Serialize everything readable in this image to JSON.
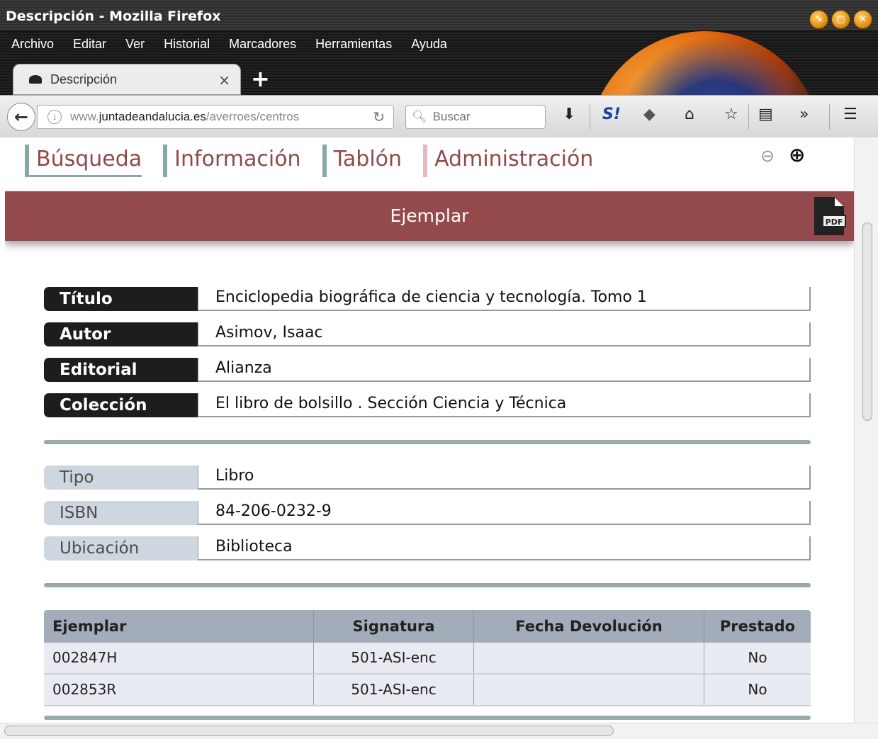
{
  "window": {
    "title": "Descripción - Mozilla Firefox"
  },
  "menubar": {
    "items": [
      "Archivo",
      "Editar",
      "Ver",
      "Historial",
      "Marcadores",
      "Herramientas",
      "Ayuda"
    ]
  },
  "tab": {
    "label": "Descripción",
    "close": "×",
    "new_tab": "+"
  },
  "navbar": {
    "url_prefix": "www.",
    "url_domain": "juntadeandalucia.es",
    "url_path": "/averroes/centros",
    "search_placeholder": "Buscar"
  },
  "site_nav": [
    "Búsqueda",
    "Información",
    "Tablón",
    "Administración"
  ],
  "banner": {
    "title": "Ejemplar",
    "pdf_label": "PDF"
  },
  "primary_fields": [
    {
      "label": "Título",
      "value": "Enciclopedia biográfica de ciencia y tecnología. Tomo 1"
    },
    {
      "label": "Autor",
      "value": "Asimov, Isaac"
    },
    {
      "label": "Editorial",
      "value": "Alianza"
    },
    {
      "label": "Colección",
      "value": "El libro de bolsillo . Sección Ciencia y Técnica"
    }
  ],
  "secondary_fields": [
    {
      "label": "Tipo",
      "value": "Libro"
    },
    {
      "label": "ISBN",
      "value": "84-206-0232-9"
    },
    {
      "label": "Ubicación",
      "value": "Biblioteca"
    }
  ],
  "copies_table": {
    "headers": [
      "Ejemplar",
      "Signatura",
      "Fecha Devolución",
      "Prestado"
    ],
    "rows": [
      [
        "002847H",
        "501-ASI-enc",
        "",
        "No"
      ],
      [
        "002853R",
        "501-ASI-enc",
        "",
        "No"
      ]
    ]
  },
  "colors": {
    "banner": "#944a4c",
    "nav_text": "#8e4a4c",
    "nav_accent": "#86a8a6",
    "table_header": "#a3adba"
  }
}
